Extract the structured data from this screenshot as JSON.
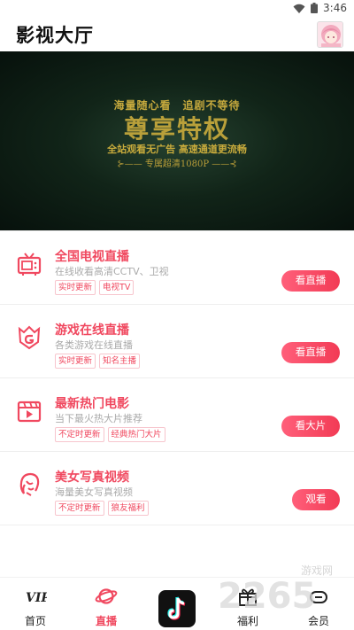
{
  "status": {
    "time": "3:46"
  },
  "header": {
    "title": "影视大厅"
  },
  "banner": {
    "line1": "海量随心看　追剧不等待",
    "line2": "尊享特权",
    "line3": "全站观看无广告 高速通道更流畅",
    "line4": "专属超清1080P"
  },
  "cards": [
    {
      "title": "全国电视直播",
      "subtitle": "在线收看高清CCTV、卫视",
      "tags": [
        "实时更新",
        "电视TV"
      ],
      "button": "看直播",
      "icon": "tv-icon"
    },
    {
      "title": "游戏在线直播",
      "subtitle": "各类游戏在线直播",
      "tags": [
        "实时更新",
        "知名主播"
      ],
      "button": "看直播",
      "icon": "game-shield-icon"
    },
    {
      "title": "最新热门电影",
      "subtitle": "当下最火热大片推荐",
      "tags": [
        "不定时更新",
        "经典热门大片"
      ],
      "button": "看大片",
      "icon": "film-icon"
    },
    {
      "title": "美女写真视频",
      "subtitle": "海量美女写真视频",
      "tags": [
        "不定时更新",
        "狼友福利"
      ],
      "button": "观看",
      "icon": "woman-profile-icon"
    }
  ],
  "nav": [
    {
      "label": "首页",
      "icon": "vip-icon"
    },
    {
      "label": "直播",
      "icon": "planet-icon",
      "active": true
    },
    {
      "label": "",
      "icon": "tiktok-icon"
    },
    {
      "label": "福利",
      "icon": "gift-icon"
    },
    {
      "label": "会员",
      "icon": "member-icon"
    }
  ],
  "watermark": {
    "text": "2265",
    "sub": "游戏网"
  },
  "colors": {
    "accent": "#f0485f",
    "banner_gold": "#c6a93d"
  }
}
